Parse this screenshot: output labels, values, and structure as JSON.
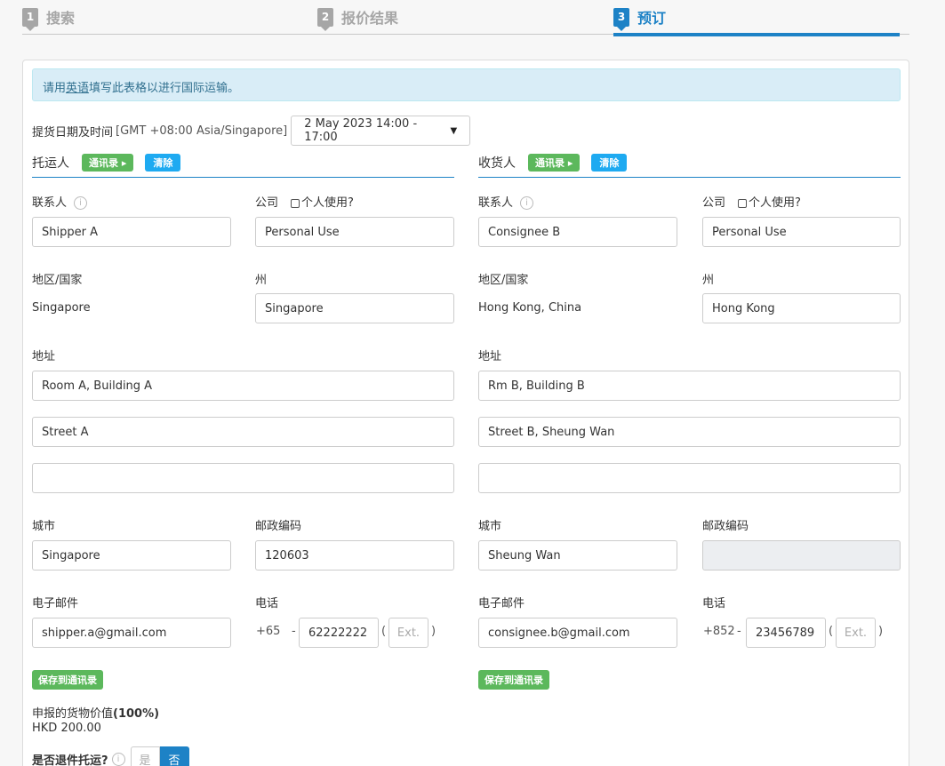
{
  "steps": [
    {
      "num": "1",
      "label": "搜索"
    },
    {
      "num": "2",
      "label": "报价结果"
    },
    {
      "num": "3",
      "label": "预订"
    }
  ],
  "notice": {
    "prefix": "请用",
    "link": "英语",
    "suffix": "填写此表格以进行国际运输。"
  },
  "pickup": {
    "label": "提货日期及时间",
    "timezone": "[GMT +08:00 Asia/Singapore]",
    "selected": "2 May 2023 14:00 - 17:00"
  },
  "labels": {
    "contact": "联系人",
    "company": "公司",
    "personal_use": "个人使用?",
    "region": "地区/国家",
    "state": "州",
    "address": "地址",
    "city": "城市",
    "postal": "邮政编码",
    "email": "电子邮件",
    "phone": "电话",
    "contacts_btn": "通讯录 ▸",
    "clear_btn": "清除",
    "save_btn": "保存到通讯录",
    "ext": "Ext."
  },
  "shipper": {
    "title": "托运人",
    "contact": "Shipper A",
    "company": "Personal Use",
    "region": "Singapore",
    "state": "Singapore",
    "address1": "Room A, Building A",
    "address2": "Street A",
    "address3": "",
    "city": "Singapore",
    "postal": "120603",
    "email": "shipper.a@gmail.com",
    "phone_code": "+65",
    "phone": "62222222"
  },
  "consignee": {
    "title": "收货人",
    "contact": "Consignee B",
    "company": "Personal Use",
    "region": "Hong Kong, China",
    "state": "Hong Kong",
    "address1": "Rm B, Building B",
    "address2": "Street B, Sheung Wan",
    "address3": "",
    "city": "Sheung Wan",
    "postal": "",
    "email": "consignee.b@gmail.com",
    "phone_code": "+852",
    "phone": "23456789"
  },
  "declared": {
    "title_prefix": "申报的货物价值",
    "title_suffix": "(100%)",
    "amount": "HKD 200.00"
  },
  "return_shipment": {
    "label": "是否退件托运?",
    "yes": "是",
    "no": "否"
  },
  "colors": {
    "primary": "#1d82c6",
    "green": "#5cb85c",
    "light_blue": "#1eaaf1",
    "notice_bg": "#d9edf7"
  }
}
